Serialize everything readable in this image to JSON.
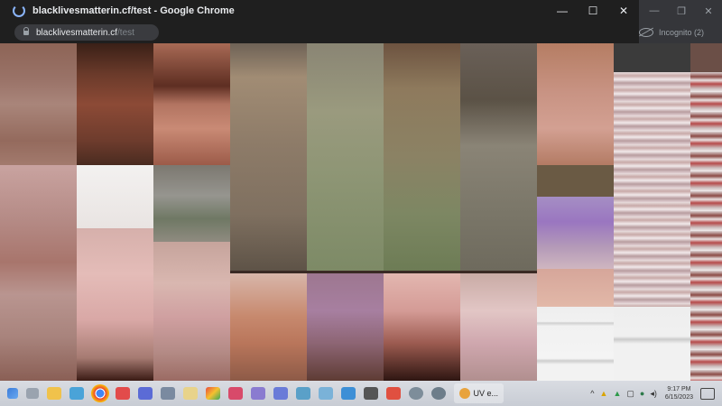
{
  "window": {
    "title": "blacklivesmatterin.cf/test - Google Chrome",
    "controls": {
      "minimize": "—",
      "maximize": "☐",
      "close": "✕"
    }
  },
  "address_bar": {
    "host": "blacklivesmatterin.cf",
    "path": "/test"
  },
  "background_window": {
    "controls": {
      "minimize": "—",
      "restore": "❐",
      "close": "✕"
    },
    "incognito_label": "Incognito (2)"
  },
  "taskbar": {
    "open_app_label": "UV e...",
    "clock": {
      "time": "9:17 PM",
      "date": "6/15/2023"
    },
    "tray_chevron": "^"
  },
  "colors": {
    "chrome_bg": "#1f1f1f",
    "accent": "#8ab4f8",
    "taskbar": "#d1d5dc"
  }
}
